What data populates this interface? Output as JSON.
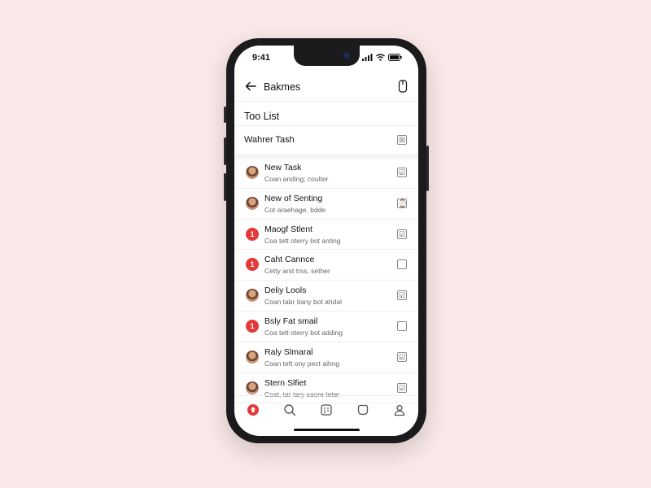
{
  "status": {
    "time": "9:41"
  },
  "header": {
    "title": "Bakmes"
  },
  "list_title": "Too List",
  "filter": {
    "label": "Wahrer Tash"
  },
  "tasks": [
    {
      "title": "New Task",
      "subtitle": "Coan anding; coulter",
      "avatar": "photo",
      "avatar_text": "",
      "checkbox": "☑"
    },
    {
      "title": "New of Senting",
      "subtitle": "Cot araehage, bdde",
      "avatar": "photo",
      "avatar_text": "",
      "checkbox": "⌚"
    },
    {
      "title": "Maogf Stlent",
      "subtitle": "Coa tett oterry bot anting",
      "avatar": "red",
      "avatar_text": "1",
      "checkbox": "☑"
    },
    {
      "title": "Caht Cannce",
      "subtitle": "Cetty arst trss, sether",
      "avatar": "red",
      "avatar_text": "1",
      "checkbox": ""
    },
    {
      "title": "Deliy Lools",
      "subtitle": "Coan tabr itany bot ahdal",
      "avatar": "photo",
      "avatar_text": "",
      "checkbox": "☑"
    },
    {
      "title": "Bsly Fat smail",
      "subtitle": "Coa tett oterry bot adding",
      "avatar": "red",
      "avatar_text": "1",
      "checkbox": ""
    },
    {
      "title": "Raly Slmaral",
      "subtitle": "Coan teft ony pect aihng",
      "avatar": "photo",
      "avatar_text": "",
      "checkbox": "☑"
    },
    {
      "title": "Stern Slfiet",
      "subtitle": "Coat, tar tary saore teter",
      "avatar": "photo",
      "avatar_text": "",
      "checkbox": "☑"
    }
  ],
  "colors": {
    "accent": "#e23a3a",
    "background": "#fbe9e9"
  },
  "tabbar": {
    "items": [
      "home-icon",
      "search-icon",
      "calendar-icon",
      "bookmark-icon",
      "profile-icon"
    ],
    "active": "home-icon"
  }
}
